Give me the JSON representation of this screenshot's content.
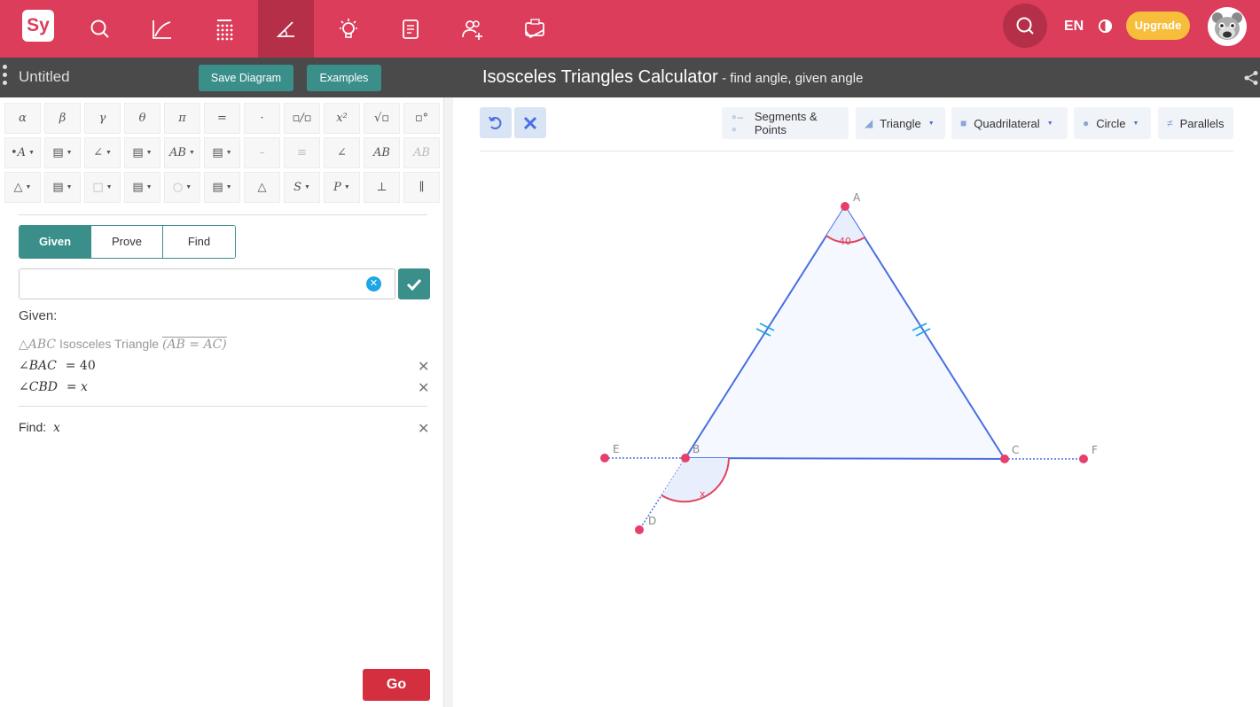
{
  "nav": {
    "logo": "Sy",
    "icons": [
      "search-icon",
      "graph-icon",
      "calculator-icon",
      "geometry-icon",
      "lightbulb-icon",
      "notebook-icon",
      "users-icon",
      "practice-icon"
    ],
    "active": "geometry-icon",
    "lang": "EN",
    "upgrade": "Upgrade",
    "accent": "#dc3d5a"
  },
  "subbar": {
    "doc_title": "Untitled",
    "save_label": "Save Diagram",
    "examples_label": "Examples",
    "title": "Isosceles Triangles Calculator",
    "subtitle": "- find angle, given angle"
  },
  "keyboard": {
    "row1": [
      "α",
      "β",
      "γ",
      "θ",
      "π",
      "=",
      "·",
      "▫/▫",
      "x²",
      "√▫",
      "▫°"
    ],
    "row2": [
      "•A",
      "▤",
      "∠",
      "▤",
      "AB",
      "▤",
      "–",
      "≡",
      "∠",
      "AB",
      "AB"
    ],
    "row3": [
      "△",
      "▤",
      "□",
      "▤",
      "○",
      "▤",
      "△",
      "S",
      "P",
      "⊥",
      "∥"
    ]
  },
  "tabs": [
    "Given",
    "Prove",
    "Find"
  ],
  "active_tab": "Given",
  "given": {
    "heading": "Given:",
    "triangle_prefix": "△ABC",
    "triangle_label": "Isosceles Triangle",
    "triangle_eq": "(AB = AC)",
    "items": [
      {
        "lhs": "∠BAC",
        "rhs": "= 40"
      },
      {
        "lhs": "∠CBD",
        "rhs": "= x"
      }
    ]
  },
  "find": {
    "label": "Find:",
    "var": "x"
  },
  "go_label": "Go",
  "tools": {
    "segments": "Segments & Points",
    "triangle": "Triangle",
    "quadrilateral": "Quadrilateral",
    "circle": "Circle",
    "parallels": "Parallels"
  },
  "diagram": {
    "points": {
      "A": "A",
      "B": "B",
      "C": "C",
      "D": "D",
      "E": "E",
      "F": "F"
    },
    "angle_A": "40",
    "angle_B": "x",
    "point_color": "#e83e6c",
    "line_color": "#4a6fe3"
  }
}
